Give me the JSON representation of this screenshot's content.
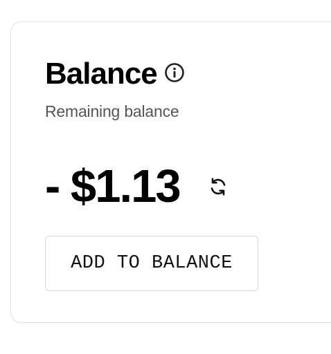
{
  "card": {
    "title": "Balance",
    "info_icon": "info-circle-icon",
    "subtitle": "Remaining balance",
    "amount": "- $1.13",
    "refresh_icon": "refresh-icon",
    "add_button_label": "ADD TO BALANCE"
  },
  "colors": {
    "text": "#000000",
    "subtitle": "#555555",
    "border": "#e3e3e3",
    "background": "#ffffff"
  }
}
